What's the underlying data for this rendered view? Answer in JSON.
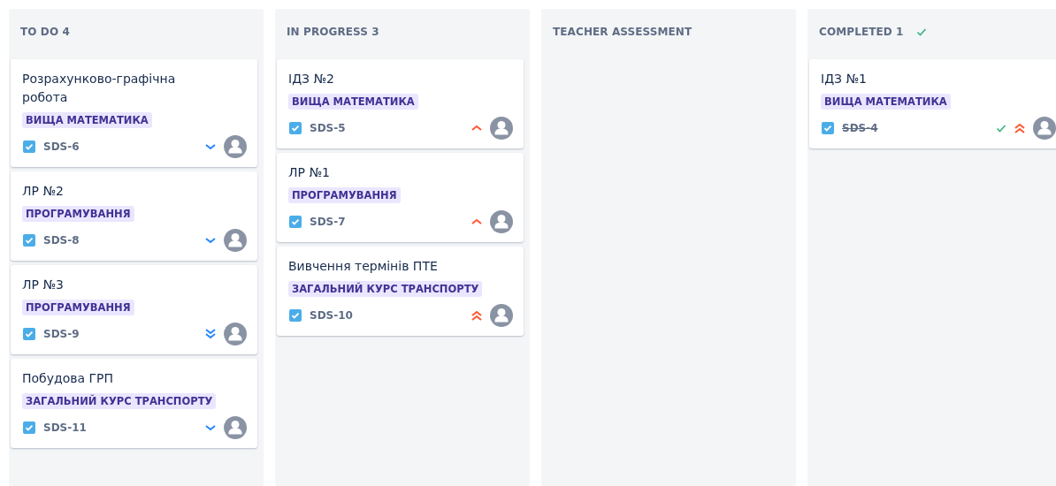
{
  "columns": [
    {
      "title": "TO DO 4",
      "done": false,
      "cards": [
        {
          "title": "Розрахунково-графічна робота",
          "tag": "ВИЩА МАТЕМАТИКА",
          "key": "SDS-6",
          "done": false,
          "kind": "low"
        },
        {
          "title": "ЛР №2",
          "tag": "ПРОГРАМУВАННЯ",
          "key": "SDS-8",
          "done": false,
          "kind": "low"
        },
        {
          "title": "ЛР №3",
          "tag": "ПРОГРАМУВАННЯ",
          "key": "SDS-9",
          "done": false,
          "kind": "lowest"
        },
        {
          "title": "Побудова ГРП",
          "tag": "ЗАГАЛЬНИЙ КУРС ТРАНСПОРТУ",
          "key": "SDS-11",
          "done": false,
          "kind": "low"
        }
      ]
    },
    {
      "title": "IN PROGRESS 3",
      "done": false,
      "cards": [
        {
          "title": "ІДЗ №2",
          "tag": "ВИЩА МАТЕМАТИКА",
          "key": "SDS-5",
          "done": false,
          "kind": "high"
        },
        {
          "title": "ЛР №1",
          "tag": "ПРОГРАМУВАННЯ",
          "key": "SDS-7",
          "done": false,
          "kind": "high"
        },
        {
          "title": "Вивчення термінів ПТЕ",
          "tag": "ЗАГАЛЬНИЙ КУРС ТРАНСПОРТУ",
          "key": "SDS-10",
          "done": false,
          "kind": "highest"
        }
      ]
    },
    {
      "title": "TEACHER ASSESSMENT",
      "done": false
    },
    {
      "title": "COMPLETED 1",
      "done": true,
      "cards": [
        {
          "title": "ІДЗ №1",
          "tag": "ВИЩА МАТЕМАТИКА",
          "key": "SDS-4",
          "done": true,
          "kind": "highest"
        }
      ]
    }
  ]
}
